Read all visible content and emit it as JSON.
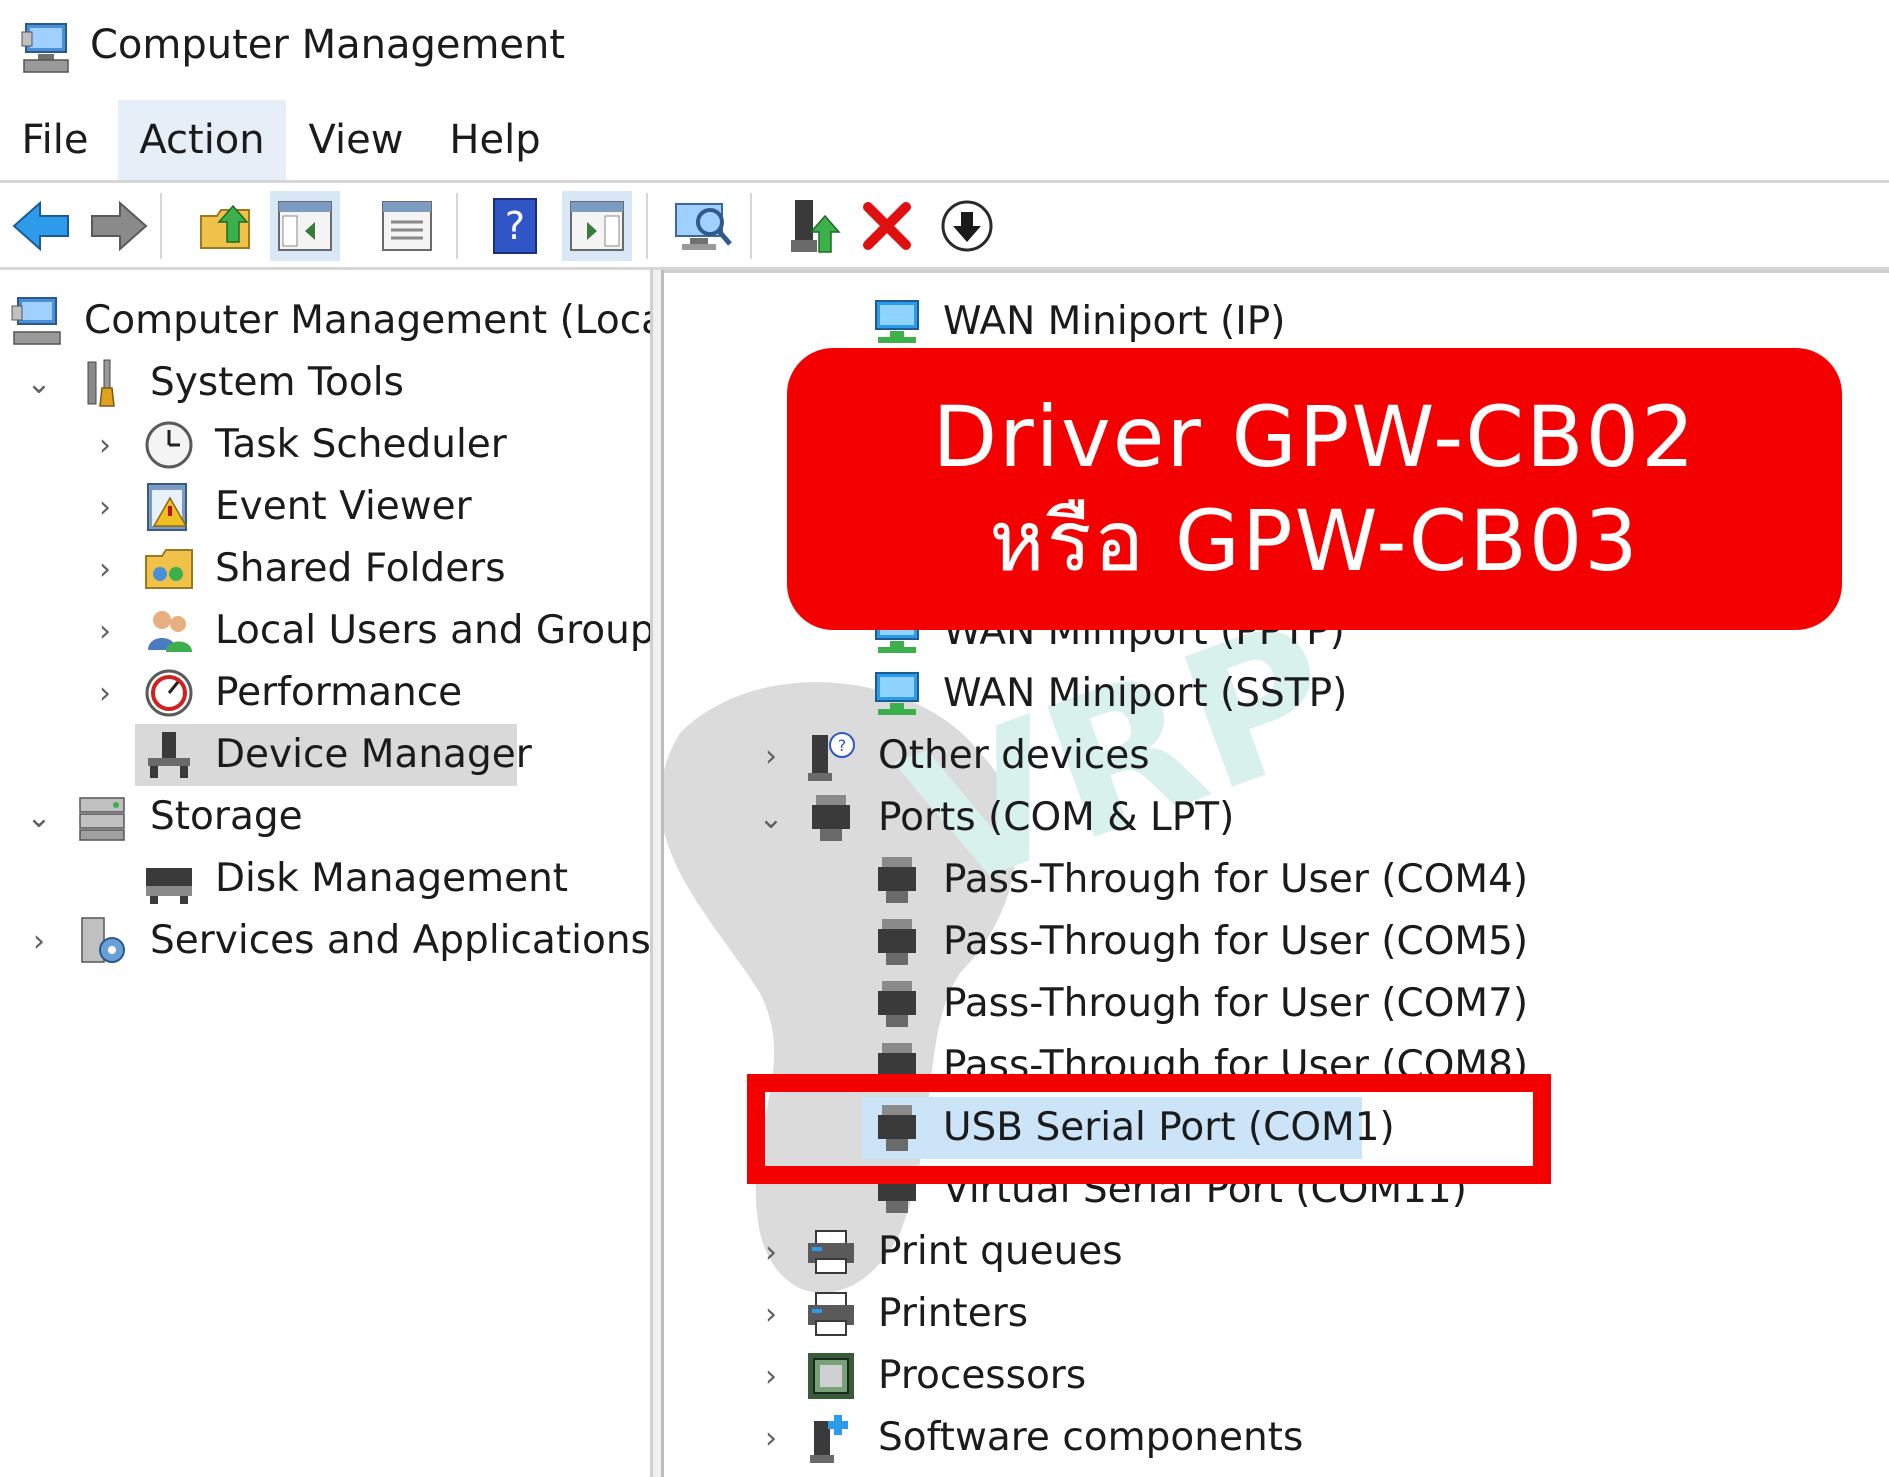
{
  "window": {
    "title": "Computer Management"
  },
  "menu": {
    "items": [
      "File",
      "Action",
      "View",
      "Help"
    ]
  },
  "toolbar": {
    "buttons": [
      "back-icon",
      "forward-icon",
      "up-folder-icon",
      "show-hide-console-tree-icon",
      "properties-icon",
      "help-icon",
      "show-hide-action-pane-icon",
      "scan-hardware-icon",
      "update-driver-icon",
      "uninstall-icon",
      "disable-device-icon"
    ]
  },
  "left_tree": {
    "root": "Computer Management (Local)",
    "system_tools": "System Tools",
    "task_scheduler": "Task Scheduler",
    "event_viewer": "Event Viewer",
    "shared_folders": "Shared Folders",
    "local_users": "Local Users and Groups",
    "performance": "Performance",
    "device_manager": "Device Manager",
    "storage": "Storage",
    "disk_management": "Disk Management",
    "services": "Services and Applications"
  },
  "right_tree": {
    "wan_ip": "WAN Miniport (IP)",
    "wan_pptp": "WAN Miniport (PPTP)",
    "wan_sstp": "WAN Miniport (SSTP)",
    "other_devices": "Other devices",
    "ports": "Ports (COM & LPT)",
    "port_items": [
      "Pass-Through for User (COM4)",
      "Pass-Through for User (COM5)",
      "Pass-Through for User (COM7)",
      "Pass-Through for User (COM8)",
      "USB Serial Port (COM1)",
      "Virtual Serial Port (COM11)"
    ],
    "print_queues": "Print queues",
    "printers": "Printers",
    "processors": "Processors",
    "software_components": "Software components"
  },
  "callout": {
    "line1": "Driver GPW-CB02",
    "line2": "หรือ GPW-CB03",
    "color": "#f40000"
  },
  "watermark": {
    "text": "VRP"
  }
}
